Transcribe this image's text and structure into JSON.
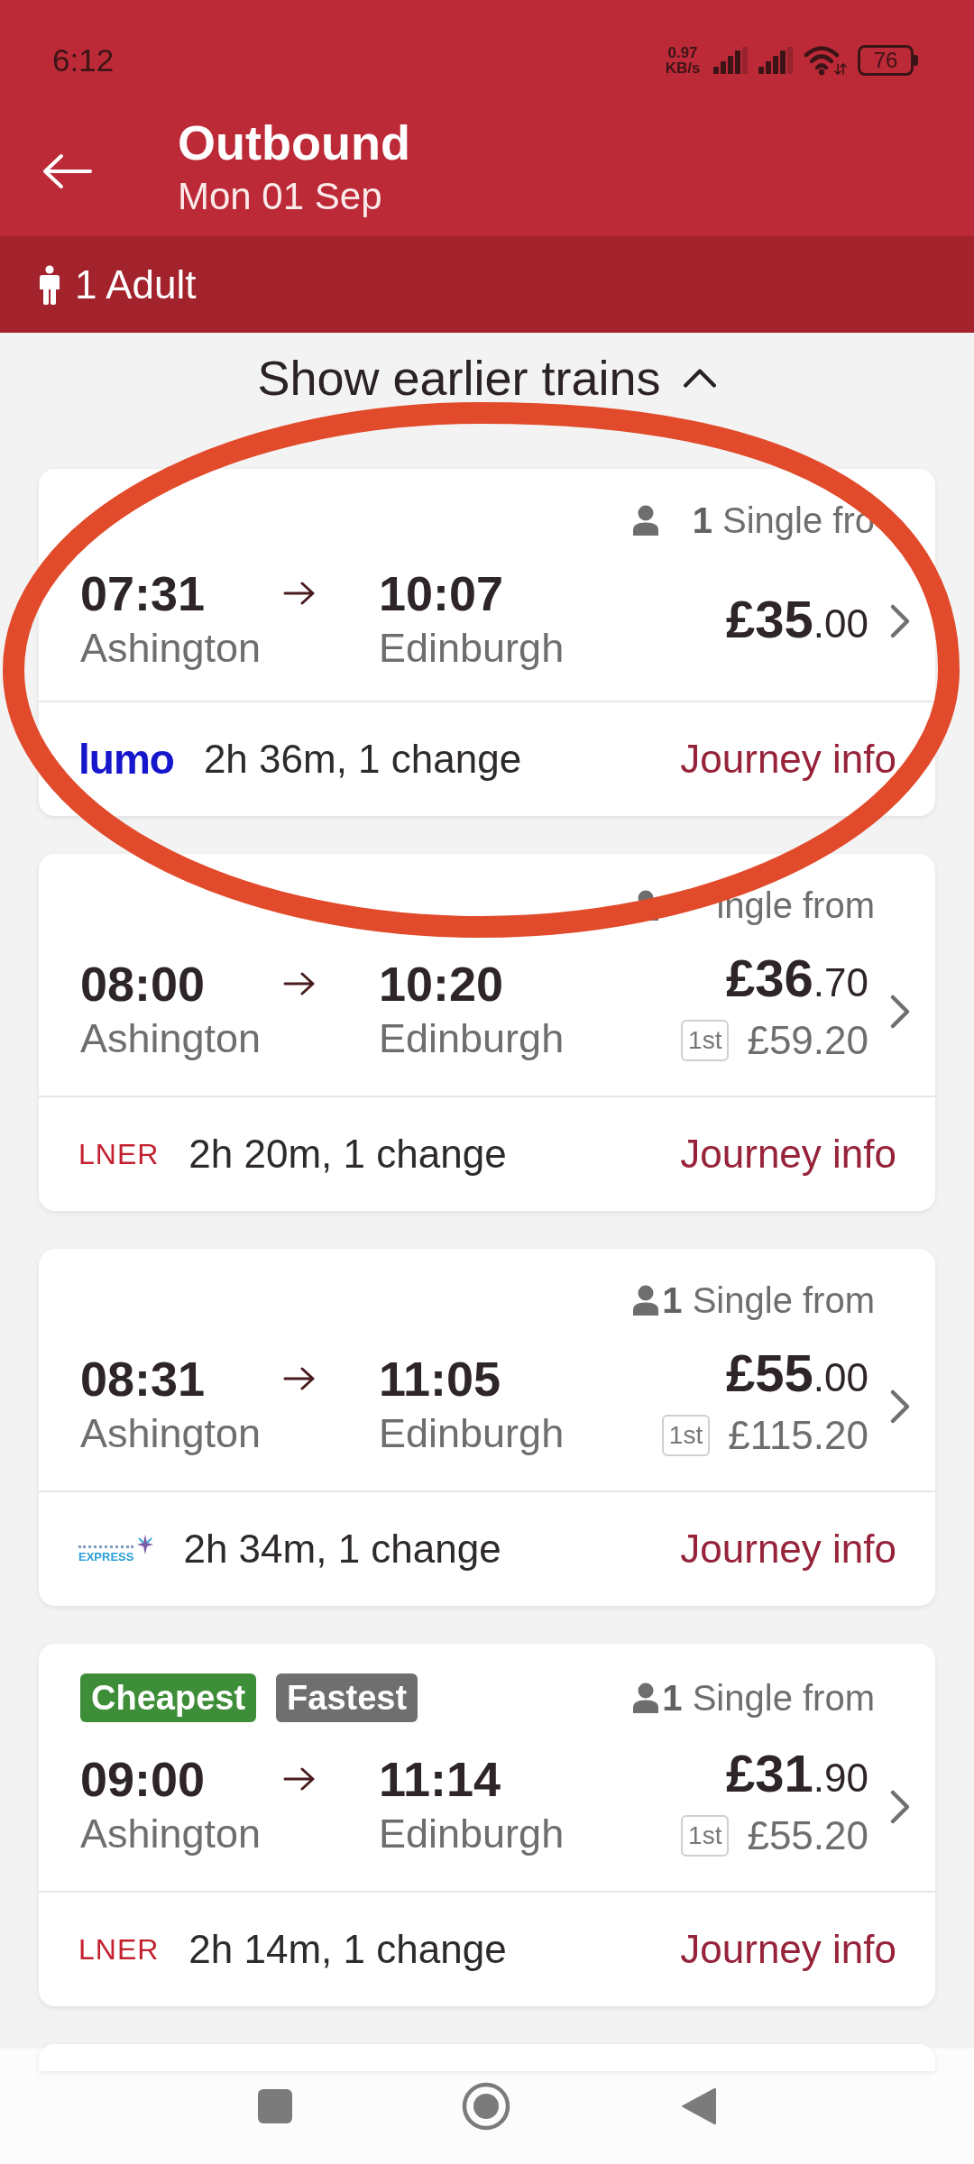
{
  "status_bar": {
    "time": "6:12",
    "net_speed": "0.97 KB/s",
    "battery": "76"
  },
  "header": {
    "title": "Outbound",
    "date": "Mon 01 Sep"
  },
  "passengers": {
    "label": "1 Adult"
  },
  "earlier_trains": {
    "label": "Show earlier trains"
  },
  "journeys": [
    {
      "circled": true,
      "fare_label": "**1** Single fro",
      "depart_time": "07:31",
      "depart_station": "Ashington",
      "arrive_time": "10:07",
      "arrive_station": "Edinburgh",
      "price": "**£35**.00",
      "operator": {
        "kind": "lumo",
        "text": "lumo"
      },
      "summary": "2h 36m, 1 change",
      "info_link": "Journey info"
    },
    {
      "circled": false,
      "fare_label": "ingle from",
      "depart_time": "08:00",
      "depart_station": "Ashington",
      "arrive_time": "10:20",
      "arrive_station": "Edinburgh",
      "price": "**£36**.70",
      "first_class": {
        "label": "1st",
        "price": "£59.20"
      },
      "operator": {
        "kind": "lner",
        "text": "LNER"
      },
      "summary": "2h 20m, 1 change",
      "info_link": "Journey info"
    },
    {
      "circled": false,
      "fare_label": "**1** Single from",
      "depart_time": "08:31",
      "depart_station": "Ashington",
      "arrive_time": "11:05",
      "arrive_station": "Edinburgh",
      "price": "**£55**.00",
      "first_class": {
        "label": "1st",
        "price": "£115.20"
      },
      "operator": {
        "kind": "tpe",
        "text": "EXPRESS"
      },
      "summary": "2h 34m, 1 change",
      "info_link": "Journey info"
    },
    {
      "circled": false,
      "tags": [
        {
          "label": "Cheapest",
          "color": "#3e8d38"
        },
        {
          "label": "Fastest",
          "color": "#6f6f6f"
        }
      ],
      "fare_label": "**1** Single from",
      "depart_time": "09:00",
      "depart_station": "Ashington",
      "arrive_time": "11:14",
      "arrive_station": "Edinburgh",
      "price": "**£31**.90",
      "first_class": {
        "label": "1st",
        "price": "£55.20"
      },
      "operator": {
        "kind": "lner",
        "text": "LNER"
      },
      "summary": "2h 14m, 1 change",
      "info_link": "Journey info"
    }
  ]
}
